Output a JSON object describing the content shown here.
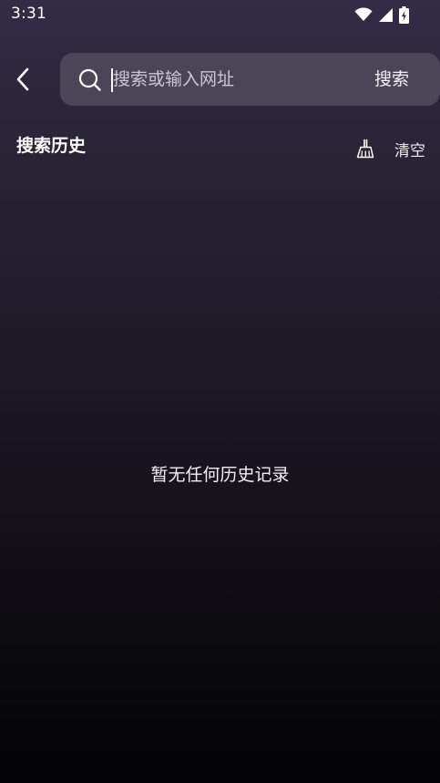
{
  "status_bar": {
    "time": "3:31",
    "icons": [
      "wifi-icon",
      "cellular-signal-icon",
      "battery-charging-icon"
    ]
  },
  "top_bar": {
    "back_icon": "chevron-left-icon",
    "search": {
      "icon": "search-icon",
      "placeholder": "搜索或输入网址",
      "value": "",
      "button_label": "搜索"
    }
  },
  "history": {
    "title": "搜索历史",
    "clear_icon": "broom-icon",
    "clear_label": "清空",
    "empty_message": "暂无任何历史记录"
  },
  "colors": {
    "background_top": "#332c45",
    "background_bottom": "#030305",
    "search_box": "#4a4658",
    "text": "#ffffff"
  }
}
